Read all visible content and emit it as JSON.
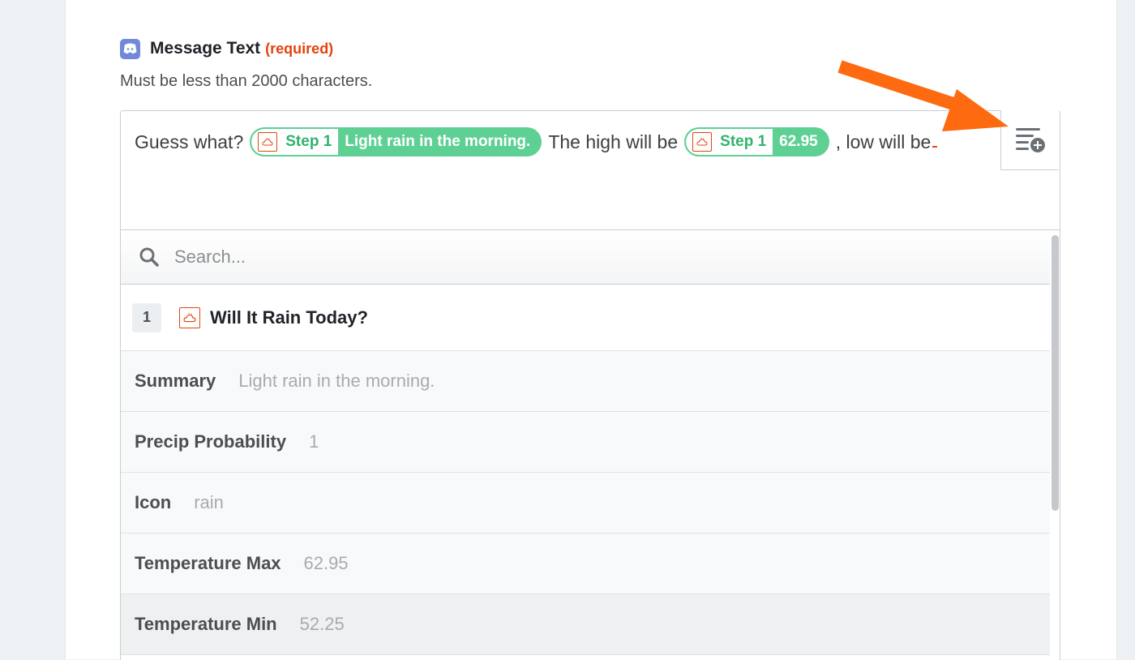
{
  "field": {
    "label": "Message Text",
    "required": "(required)",
    "help": "Must be less than 2000 characters."
  },
  "editor": {
    "text_before": "Guess what?",
    "pill1": {
      "step": "Step 1",
      "value": "Light rain in the morning."
    },
    "text_middle": "The high will be",
    "pill2": {
      "step": "Step 1",
      "value": "62.95"
    },
    "text_after": ", low will be"
  },
  "search": {
    "placeholder": "Search..."
  },
  "group": {
    "number": "1",
    "title": "Will It Rain Today?"
  },
  "rows": [
    {
      "key": "Summary",
      "value": "Light rain in the morning."
    },
    {
      "key": "Precip Probability",
      "value": "1"
    },
    {
      "key": "Icon",
      "value": "rain"
    },
    {
      "key": "Temperature Max",
      "value": "62.95"
    },
    {
      "key": "Temperature Min",
      "value": "52.25"
    }
  ],
  "colors": {
    "accent_orange": "#fd6a0f",
    "pill_green": "#5fd094",
    "discord_blue": "#7289da",
    "required_red": "#e5430b"
  }
}
